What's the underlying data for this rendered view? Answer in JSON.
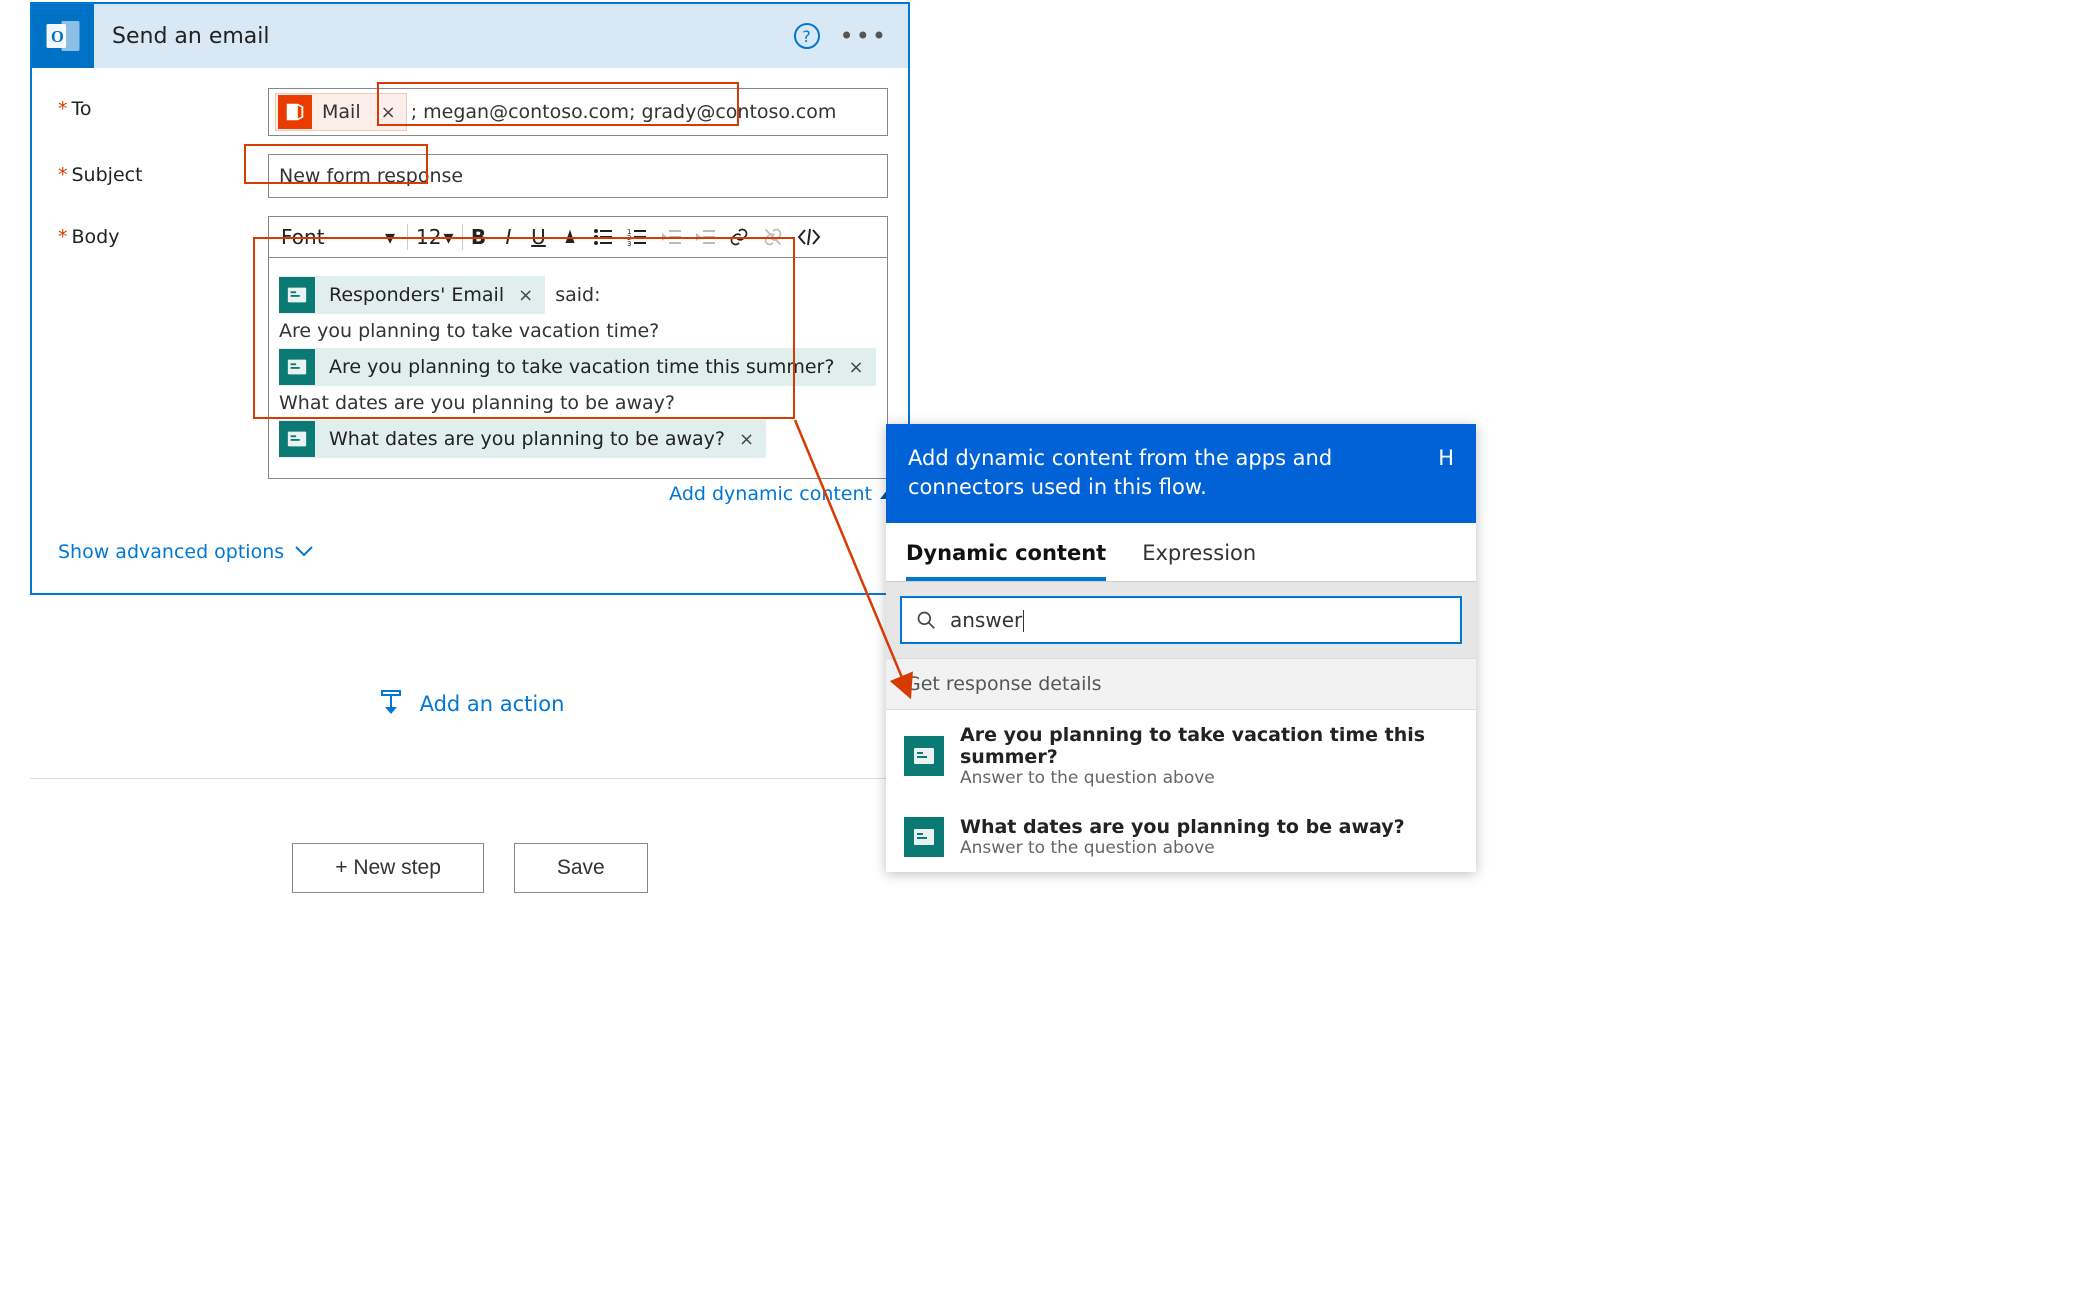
{
  "header": {
    "title": "Send an email"
  },
  "fields": {
    "to_label": "To",
    "subject_label": "Subject",
    "body_label": "Body"
  },
  "to_token": {
    "label": "Mail"
  },
  "to_text": "; megan@contoso.com; grady@contoso.com",
  "subject_value": "New form response",
  "toolbar": {
    "font_label": "Font",
    "size_label": "12"
  },
  "body": {
    "token1": "Responders' Email",
    "after_token1": "said:",
    "line2": "Are you planning to take vacation time?",
    "token2": "Are you planning to take vacation time this summer?",
    "line3": "What dates are you planning to be away?",
    "token3": "What dates are you planning to be away?"
  },
  "links": {
    "add_dynamic": "Add dynamic content",
    "show_advanced": "Show advanced options",
    "add_action": "Add an action"
  },
  "buttons": {
    "new_step": "+ New step",
    "save": "Save"
  },
  "popover": {
    "header_text": "Add dynamic content from the apps and connectors used in this flow.",
    "hide_link": "H",
    "tab_dynamic": "Dynamic content",
    "tab_expression": "Expression",
    "search_value": "answer",
    "section": "Get response details",
    "results": [
      {
        "title": "Are you planning to take vacation time this summer?",
        "sub": "Answer to the question above"
      },
      {
        "title": "What dates are you planning to be away?",
        "sub": "Answer to the question above"
      }
    ]
  },
  "colors": {
    "primary": "#0078d4",
    "danger": "#d83b01",
    "teal": "#0b7a75",
    "orange": "#eb3c00"
  }
}
